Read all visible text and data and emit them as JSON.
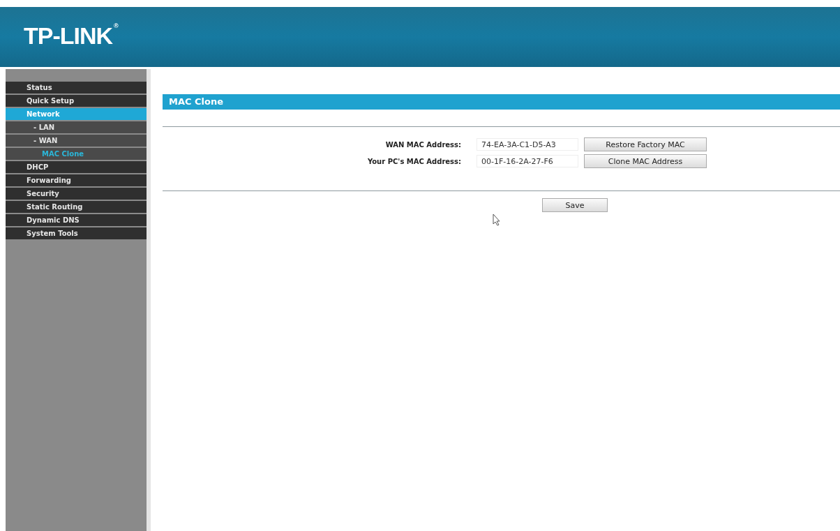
{
  "header": {
    "logo": "TP-LINK",
    "logo_mark": "®"
  },
  "menu": [
    {
      "label": "Status",
      "selected": false
    },
    {
      "label": "Quick Setup",
      "selected": false
    },
    {
      "label": "Network",
      "selected": true,
      "children": [
        {
          "label": "- LAN",
          "selected": false
        },
        {
          "label": "- WAN",
          "selected": false
        },
        {
          "label": "MAC Clone",
          "selected": true
        }
      ]
    },
    {
      "label": "DHCP",
      "selected": false
    },
    {
      "label": "Forwarding",
      "selected": false
    },
    {
      "label": "Security",
      "selected": false
    },
    {
      "label": "Static Routing",
      "selected": false
    },
    {
      "label": "Dynamic DNS",
      "selected": false
    },
    {
      "label": "System Tools",
      "selected": false
    }
  ],
  "section_title": "MAC Clone",
  "fields": [
    {
      "label": "WAN MAC Address:",
      "value": "74-EA-3A-C1-D5-A3",
      "button": "Restore Factory MAC"
    },
    {
      "label": "Your PC's MAC Address:",
      "value": "00-1F-16-2A-27-F6",
      "button": "Clone MAC Address"
    }
  ],
  "save_button": "Save"
}
